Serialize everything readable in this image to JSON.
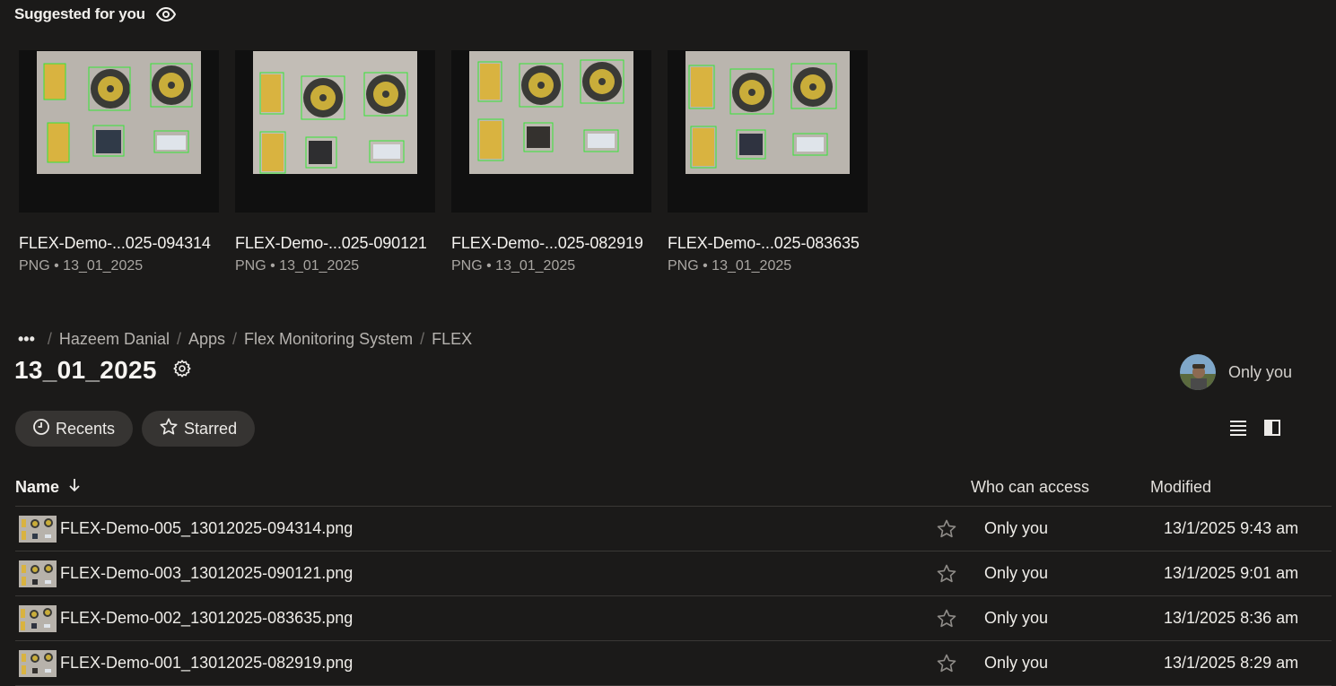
{
  "suggested": {
    "heading": "Suggested for you",
    "cards": [
      {
        "title": "FLEX-Demo-...025-094314",
        "meta": "PNG • 13_01_2025"
      },
      {
        "title": "FLEX-Demo-...025-090121",
        "meta": "PNG • 13_01_2025"
      },
      {
        "title": "FLEX-Demo-...025-082919",
        "meta": "PNG • 13_01_2025"
      },
      {
        "title": "FLEX-Demo-...025-083635",
        "meta": "PNG • 13_01_2025"
      }
    ]
  },
  "breadcrumb": {
    "overflow": "•••",
    "items": [
      "Hazeem Danial",
      "Apps",
      "Flex Monitoring System",
      "FLEX"
    ]
  },
  "folder": {
    "title": "13_01_2025",
    "sharing": "Only you"
  },
  "filters": {
    "recents": "Recents",
    "starred": "Starred"
  },
  "table": {
    "headers": {
      "name": "Name",
      "access": "Who can access",
      "modified": "Modified"
    },
    "rows": [
      {
        "name": "FLEX-Demo-005_13012025-094314.png",
        "access": "Only you",
        "modified": "13/1/2025 9:43 am"
      },
      {
        "name": "FLEX-Demo-003_13012025-090121.png",
        "access": "Only you",
        "modified": "13/1/2025 9:01 am"
      },
      {
        "name": "FLEX-Demo-002_13012025-083635.png",
        "access": "Only you",
        "modified": "13/1/2025 8:36 am"
      },
      {
        "name": "FLEX-Demo-001_13012025-082919.png",
        "access": "Only you",
        "modified": "13/1/2025 8:29 am"
      }
    ]
  },
  "colors": {
    "background": "#1b1a19",
    "chip": "#363432",
    "thumbnail_bg": "#101010",
    "detection_box": "#37e637"
  },
  "icons": [
    "eye-icon",
    "settings-gear-icon",
    "clock-icon",
    "star-icon",
    "sort-arrow-down-icon",
    "list-view-icon",
    "side-panel-icon"
  ]
}
